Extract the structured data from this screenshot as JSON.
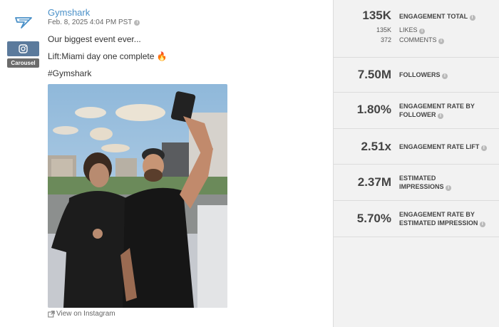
{
  "post": {
    "author": "Gymshark",
    "date": "Feb. 8, 2025 4:04 PM PST",
    "platform_badge": "Carousel",
    "caption_lines": [
      "Our biggest event ever...",
      "Lift:Miami day one complete",
      "#Gymshark"
    ],
    "caption_emoji": "🔥",
    "view_link": "View on Instagram",
    "icons": {
      "brand": "gymshark-logo-icon",
      "platform": "instagram-icon",
      "external": "external-link-icon",
      "info": "info-icon"
    }
  },
  "metrics": {
    "engagement_total": {
      "value": "135K",
      "label": "ENGAGEMENT TOTAL"
    },
    "likes": {
      "value": "135K",
      "label": "LIKES"
    },
    "comments": {
      "value": "372",
      "label": "COMMENTS"
    },
    "followers": {
      "value": "7.50M",
      "label": "FOLLOWERS"
    },
    "engagement_rate_follower": {
      "value": "1.80%",
      "label_line1": "ENGAGEMENT RATE BY",
      "label_line2": "FOLLOWER"
    },
    "engagement_rate_lift": {
      "value": "2.51x",
      "label": "ENGAGEMENT RATE LIFT"
    },
    "estimated_impressions": {
      "value": "2.37M",
      "label_line1": "ESTIMATED",
      "label_line2": "IMPRESSIONS"
    },
    "engagement_rate_impression": {
      "value": "5.70%",
      "label_line1": "ENGAGEMENT RATE BY",
      "label_line2": "ESTIMATED IMPRESSION"
    }
  },
  "colors": {
    "accent": "#4a90c8",
    "instagram_badge": "#5b7a9c",
    "panel_bg": "#f2f2f2"
  }
}
